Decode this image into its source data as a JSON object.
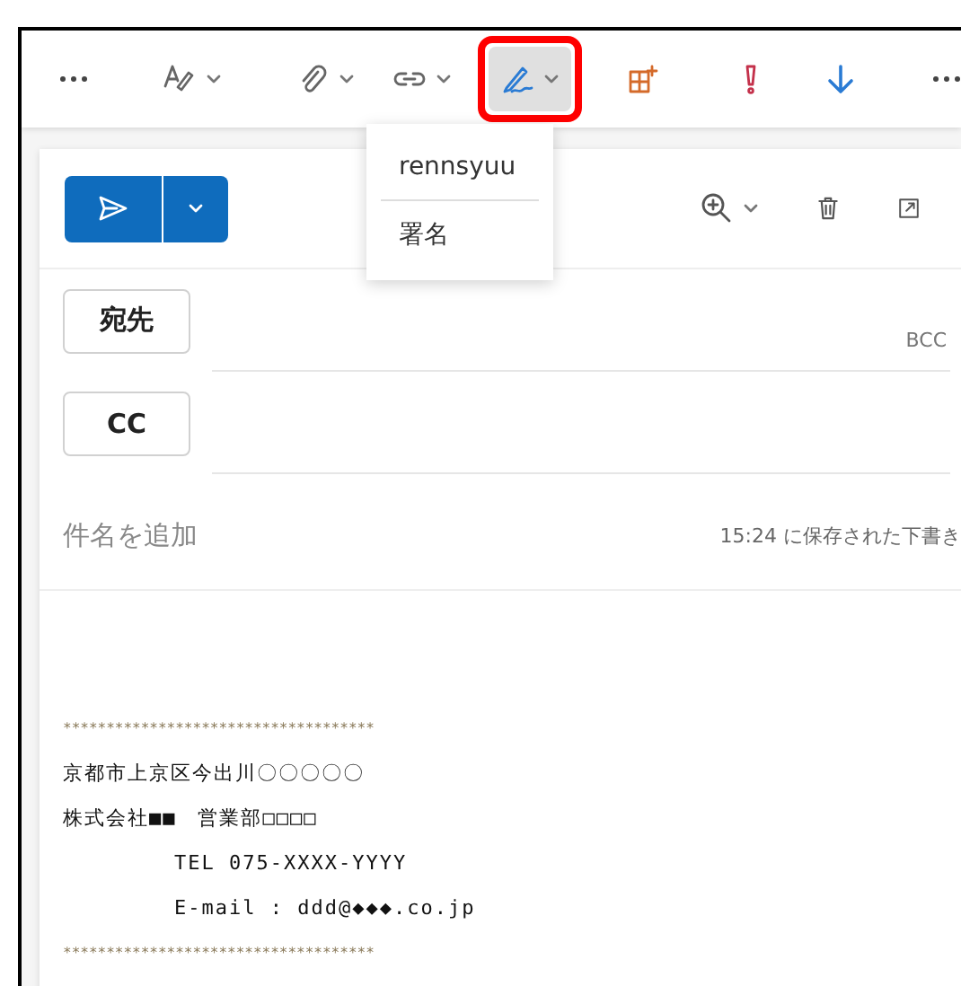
{
  "toolbar": {
    "signature_open": true
  },
  "signature_menu": {
    "items": [
      {
        "label": "rennsyuu",
        "kind": "signature"
      },
      {
        "label": "署名",
        "kind": "settings"
      }
    ]
  },
  "header": {
    "to_label": "宛先",
    "bcc_label": "BCC",
    "cc_label": "CC"
  },
  "subject": {
    "placeholder": "件名を追加",
    "saved_note": "15:24 に保存された下書き"
  },
  "body": [
    {
      "kind": "rule",
      "text": "************************************"
    },
    {
      "kind": "line",
      "text": "京都市上京区今出川〇〇〇〇〇"
    },
    {
      "kind": "line",
      "text": "株式会社■■　営業部□□□□"
    },
    {
      "kind": "indented",
      "text": "TEL 075-XXXX-YYYY"
    },
    {
      "kind": "indented",
      "text": "E-mail : ddd@◆◆◆.co.jp"
    },
    {
      "kind": "rule",
      "text": "************************************"
    }
  ]
}
